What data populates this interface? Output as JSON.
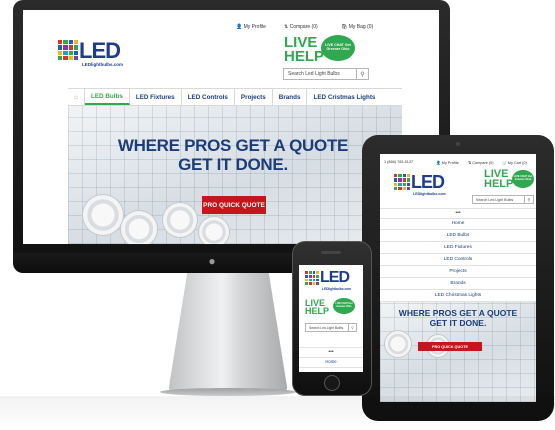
{
  "brand": {
    "logo_text": "LED",
    "logo_sub": "LEDlightbulbs.com",
    "colors": {
      "navy": "#1c3d7a",
      "green": "#2fa84f",
      "red": "#c4161c"
    }
  },
  "live_help": {
    "title_line1": "LIVE",
    "title_line2": "HELP",
    "bubble_text": "LIVE CHAT Get Greener Ohio"
  },
  "search": {
    "placeholder": "Search Led Light Bulbs",
    "icon": "magnifier-icon"
  },
  "desktop": {
    "util_nav": {
      "profile": "My Profile",
      "compare": "Compare (0)",
      "bag": "My Bag (0)"
    },
    "nav": [
      "LED Bulbs",
      "LED Fixtures",
      "LED Controls",
      "Projects",
      "Brands",
      "LED Cristmas Lights"
    ],
    "nav_active": "LED Bulbs",
    "hero": {
      "line1": "WHERE PROS GET A QUOTE",
      "line2": "GET IT  DONE.",
      "cta": "PRO QUICK QUOTE"
    }
  },
  "tablet": {
    "phone": "1 (866) 783-5137",
    "util_nav": {
      "profile": "My Profile",
      "compare": "Compare (0)",
      "bag": "My Cart (0)"
    },
    "menu_toggle": "•••",
    "menu": [
      "Home",
      "LED Bulbs",
      "LED Fixtures",
      "LED Controls",
      "Projects",
      "Brands",
      "LED Christmas Lights"
    ],
    "hero": {
      "line1": "WHERE PROS GET A QUOTE",
      "line2": "GET IT  DONE.",
      "cta": "PRO QUICK QUOTE"
    }
  },
  "phone": {
    "menu_toggle": "•••",
    "menu": [
      "Home"
    ]
  }
}
